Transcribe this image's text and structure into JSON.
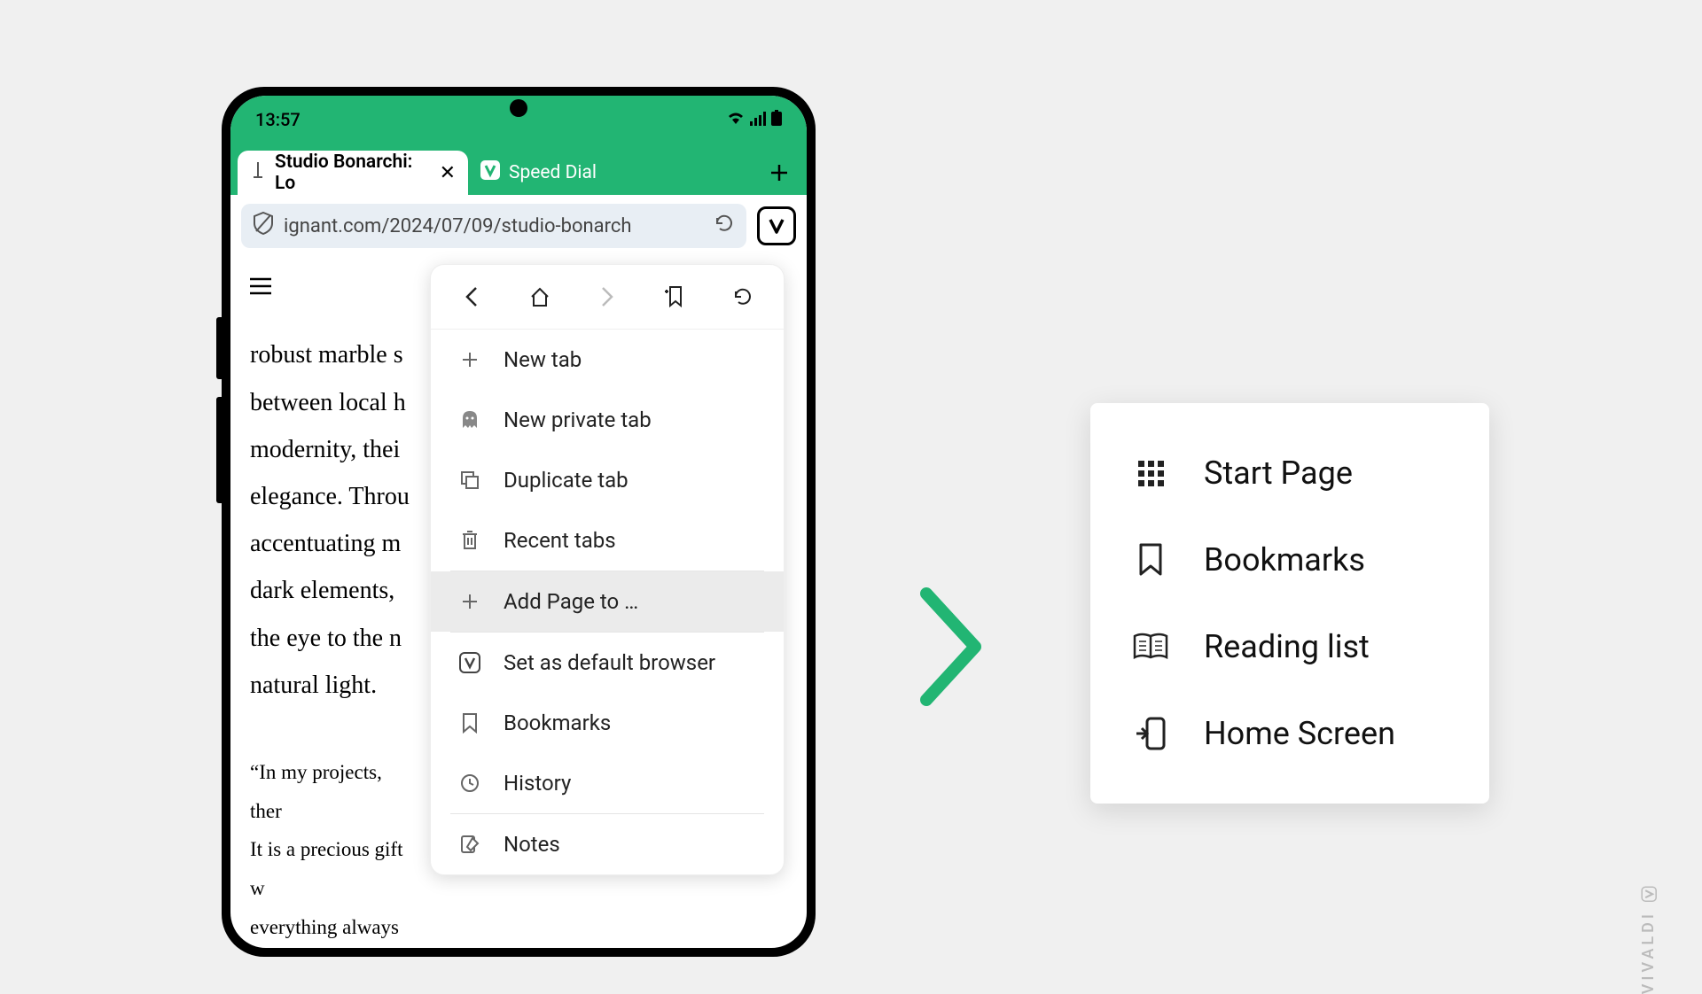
{
  "status": {
    "time": "13:57"
  },
  "tabs": {
    "active": {
      "title": "Studio Bonarchi: Lo"
    },
    "inactive": {
      "title": "Speed Dial"
    }
  },
  "address": {
    "url": "ignant.com/2024/07/09/studio-bonarch"
  },
  "page": {
    "text1": "robust marble s between local h modernity, thei elegance. Throu accentuating m dark elements, the eye to the n natural light.",
    "text2": "“In my projects, ther It is a precious gift w everything always be"
  },
  "menu": {
    "new_tab": "New tab",
    "new_private_tab": "New private tab",
    "duplicate_tab": "Duplicate tab",
    "recent_tabs": "Recent tabs",
    "add_page_to": "Add Page to …",
    "set_default": "Set as default browser",
    "bookmarks": "Bookmarks",
    "history": "History",
    "notes": "Notes"
  },
  "submenu": {
    "start_page": "Start Page",
    "bookmarks": "Bookmarks",
    "reading_list": "Reading list",
    "home_screen": "Home Screen"
  },
  "brand": "VIVALDI"
}
